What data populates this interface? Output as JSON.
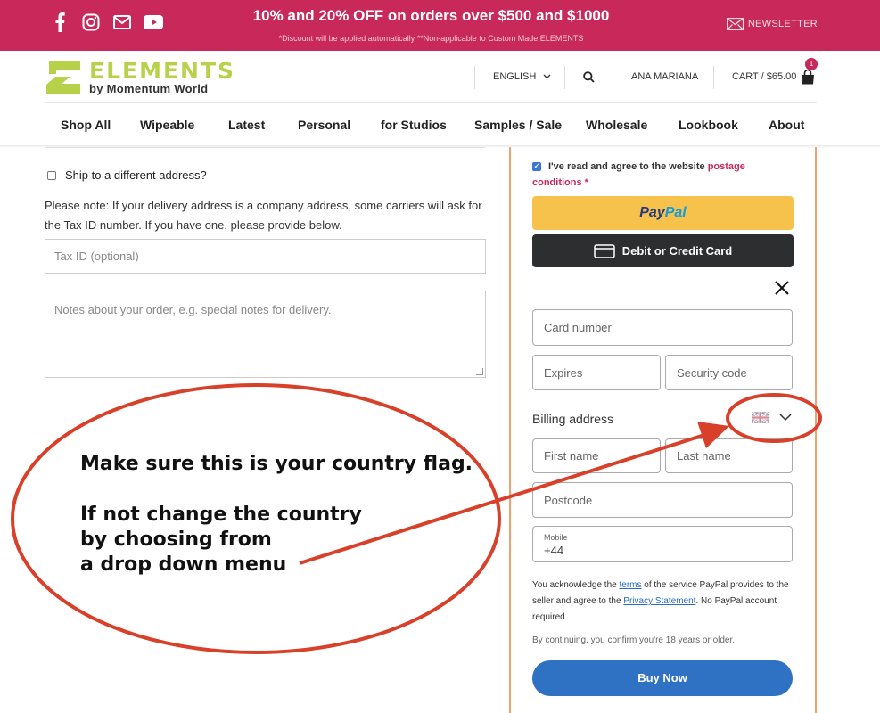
{
  "topbar": {
    "promo": "10% and 20% OFF on orders over $500 and $1000",
    "sub": "*Discount will be applied automatically  **Non-applicable to Custom Made ELEMENTS",
    "newsletter": "NEWSLETTER",
    "bg_color": "#c8285a"
  },
  "logo": {
    "word": "ELEMENTS",
    "sub": "by Momentum World",
    "color": "#b8d14a"
  },
  "header": {
    "language": "ENGLISH",
    "user": "ANA MARIANA",
    "cart": "CART / $65.00",
    "cart_count": "1"
  },
  "nav": {
    "items": [
      "Shop All",
      "Wipeable",
      "Latest",
      "Personal",
      "for Studios",
      "Samples / Sale",
      "Wholesale",
      "Lookbook",
      "About"
    ]
  },
  "form": {
    "ship_label": "Ship to a different address?",
    "note": "Please note: If your delivery address is a company address, some carriers will ask for the Tax ID number. If you have one, please provide below.",
    "tax_placeholder": "Tax ID (optional)",
    "notes_placeholder": "Notes about your order, e.g. special notes for delivery."
  },
  "checkout": {
    "agree_text": "I've read and agree to the website ",
    "agree_link": "postage conditions",
    "agree_req": " *",
    "paypal_pay": "Pay",
    "paypal_pal": "Pal",
    "card_btn": "Debit or Credit Card",
    "card_number": "Card number",
    "expires": "Expires",
    "security_code": "Security code",
    "billing_address": "Billing address",
    "first_name": "First name",
    "last_name": "Last name",
    "postcode": "Postcode",
    "mobile_label": "Mobile",
    "mobile_value": "+44",
    "legal_1": "You acknowledge the ",
    "legal_terms": "terms",
    "legal_2": " of the service PayPal provides to the seller and agree to the ",
    "legal_privacy": "Privacy Statement",
    "legal_3": ". No PayPal account required.",
    "age_note": "By continuing, you confirm you're 18 years or older.",
    "buy_now": "Buy Now"
  },
  "annotation": {
    "line1": "Make sure this is your country flag.",
    "line2": "If  not change the country",
    "line3": "by choosing from",
    "line4": "a drop down menu",
    "color": "#d8402a"
  }
}
